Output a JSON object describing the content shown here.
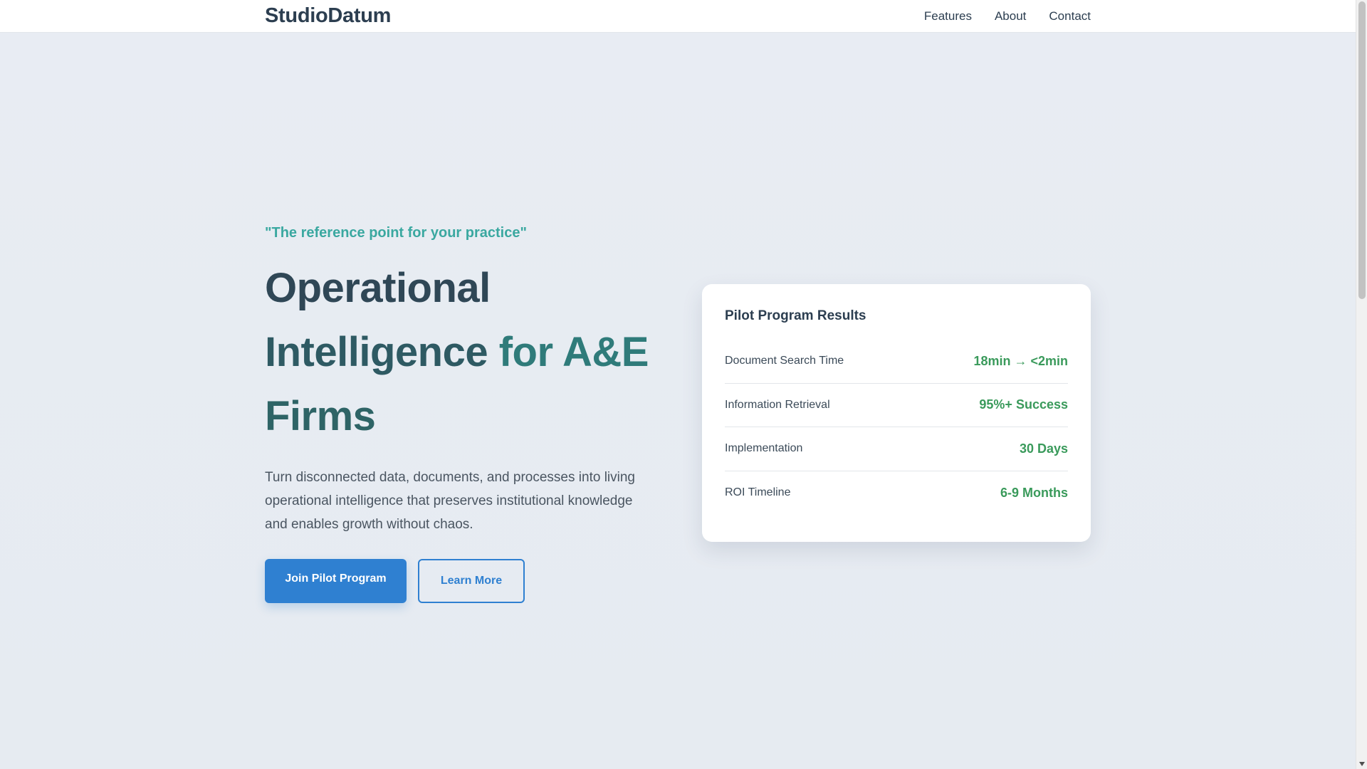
{
  "header": {
    "brand": "StudioDatum",
    "nav": [
      {
        "label": "Features"
      },
      {
        "label": "About"
      },
      {
        "label": "Contact"
      }
    ]
  },
  "hero": {
    "tagline": "\"The reference point for your practice\"",
    "headline": {
      "line1": "Operational",
      "line2_a": "Intelligence",
      "line2_b": " for A&E",
      "line3": "Firms"
    },
    "description": "Turn disconnected data, documents, and processes into living operational intelligence that preserves institutional knowledge and enables growth without chaos.",
    "primary_button": "Join Pilot Program",
    "secondary_button": "Learn More"
  },
  "results_card": {
    "title": "Pilot Program Results",
    "metrics": [
      {
        "label": "Document Search Time",
        "value": "18min → <2min"
      },
      {
        "label": "Information Retrieval",
        "value": "95%+ Success"
      },
      {
        "label": "Implementation",
        "value": "30 Days"
      },
      {
        "label": "ROI Timeline",
        "value": "6-9 Months"
      }
    ]
  },
  "colors": {
    "primary_blue": "#2f80d1",
    "teal": "#3aa8a0",
    "dark_text": "#2c3e50",
    "success_green": "#3a9a5b",
    "background": "#e8ecf2"
  }
}
